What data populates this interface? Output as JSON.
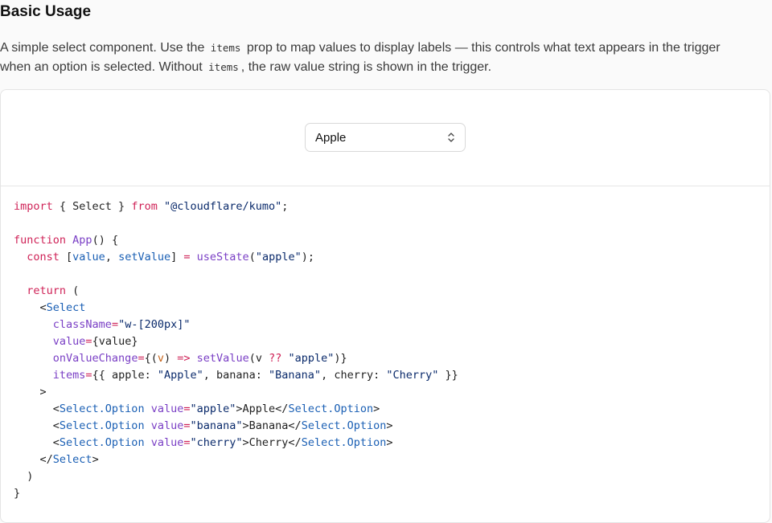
{
  "section": {
    "title": "Basic Usage",
    "description": {
      "part1": "A simple select component. Use the ",
      "code1": "items",
      "part2": " prop to map values to display labels — this controls what text appears in the trigger",
      "part3": "when an option is selected. Without ",
      "code2": "items",
      "part4": ", the raw value string is shown in the trigger."
    }
  },
  "preview": {
    "select": {
      "value": "Apple",
      "icon": "chevron-up-down-icon"
    }
  },
  "code_lines": [
    [
      {
        "t": "import",
        "c": "kw"
      },
      {
        "t": " { Select } ",
        "c": "plain"
      },
      {
        "t": "from",
        "c": "kw"
      },
      {
        "t": " ",
        "c": "plain"
      },
      {
        "t": "\"@cloudflare/kumo\"",
        "c": "str"
      },
      {
        "t": ";",
        "c": "plain"
      }
    ],
    [],
    [
      {
        "t": "function",
        "c": "kw"
      },
      {
        "t": " ",
        "c": "plain"
      },
      {
        "t": "App",
        "c": "fn"
      },
      {
        "t": "() {",
        "c": "plain"
      }
    ],
    [
      {
        "t": "  ",
        "c": "plain"
      },
      {
        "t": "const",
        "c": "kw"
      },
      {
        "t": " [",
        "c": "plain"
      },
      {
        "t": "value",
        "c": "tag"
      },
      {
        "t": ", ",
        "c": "plain"
      },
      {
        "t": "setValue",
        "c": "tag"
      },
      {
        "t": "] ",
        "c": "plain"
      },
      {
        "t": "=",
        "c": "op"
      },
      {
        "t": " ",
        "c": "plain"
      },
      {
        "t": "useState",
        "c": "fn"
      },
      {
        "t": "(",
        "c": "plain"
      },
      {
        "t": "\"apple\"",
        "c": "str"
      },
      {
        "t": ");",
        "c": "plain"
      }
    ],
    [],
    [
      {
        "t": "  ",
        "c": "plain"
      },
      {
        "t": "return",
        "c": "kw"
      },
      {
        "t": " (",
        "c": "plain"
      }
    ],
    [
      {
        "t": "    <",
        "c": "plain"
      },
      {
        "t": "Select",
        "c": "tag"
      }
    ],
    [
      {
        "t": "      ",
        "c": "plain"
      },
      {
        "t": "className",
        "c": "attr"
      },
      {
        "t": "=",
        "c": "op"
      },
      {
        "t": "\"w-[200px]\"",
        "c": "str"
      }
    ],
    [
      {
        "t": "      ",
        "c": "plain"
      },
      {
        "t": "value",
        "c": "attr"
      },
      {
        "t": "=",
        "c": "op"
      },
      {
        "t": "{value}",
        "c": "plain"
      }
    ],
    [
      {
        "t": "      ",
        "c": "plain"
      },
      {
        "t": "onValueChange",
        "c": "attr"
      },
      {
        "t": "=",
        "c": "op"
      },
      {
        "t": "{(",
        "c": "plain"
      },
      {
        "t": "v",
        "c": "prm"
      },
      {
        "t": ") ",
        "c": "plain"
      },
      {
        "t": "=>",
        "c": "op"
      },
      {
        "t": " ",
        "c": "plain"
      },
      {
        "t": "setValue",
        "c": "fn"
      },
      {
        "t": "(v ",
        "c": "plain"
      },
      {
        "t": "??",
        "c": "op"
      },
      {
        "t": " ",
        "c": "plain"
      },
      {
        "t": "\"apple\"",
        "c": "str"
      },
      {
        "t": ")}",
        "c": "plain"
      }
    ],
    [
      {
        "t": "      ",
        "c": "plain"
      },
      {
        "t": "items",
        "c": "attr"
      },
      {
        "t": "=",
        "c": "op"
      },
      {
        "t": "{{ apple: ",
        "c": "plain"
      },
      {
        "t": "\"Apple\"",
        "c": "str"
      },
      {
        "t": ", banana: ",
        "c": "plain"
      },
      {
        "t": "\"Banana\"",
        "c": "str"
      },
      {
        "t": ", cherry: ",
        "c": "plain"
      },
      {
        "t": "\"Cherry\"",
        "c": "str"
      },
      {
        "t": " }}",
        "c": "plain"
      }
    ],
    [
      {
        "t": "    >",
        "c": "plain"
      }
    ],
    [
      {
        "t": "      <",
        "c": "plain"
      },
      {
        "t": "Select.Option",
        "c": "tag"
      },
      {
        "t": " ",
        "c": "plain"
      },
      {
        "t": "value",
        "c": "attr"
      },
      {
        "t": "=",
        "c": "op"
      },
      {
        "t": "\"apple\"",
        "c": "str"
      },
      {
        "t": ">Apple</",
        "c": "plain"
      },
      {
        "t": "Select.Option",
        "c": "tag"
      },
      {
        "t": ">",
        "c": "plain"
      }
    ],
    [
      {
        "t": "      <",
        "c": "plain"
      },
      {
        "t": "Select.Option",
        "c": "tag"
      },
      {
        "t": " ",
        "c": "plain"
      },
      {
        "t": "value",
        "c": "attr"
      },
      {
        "t": "=",
        "c": "op"
      },
      {
        "t": "\"banana\"",
        "c": "str"
      },
      {
        "t": ">Banana</",
        "c": "plain"
      },
      {
        "t": "Select.Option",
        "c": "tag"
      },
      {
        "t": ">",
        "c": "plain"
      }
    ],
    [
      {
        "t": "      <",
        "c": "plain"
      },
      {
        "t": "Select.Option",
        "c": "tag"
      },
      {
        "t": " ",
        "c": "plain"
      },
      {
        "t": "value",
        "c": "attr"
      },
      {
        "t": "=",
        "c": "op"
      },
      {
        "t": "\"cherry\"",
        "c": "str"
      },
      {
        "t": ">Cherry</",
        "c": "plain"
      },
      {
        "t": "Select.Option",
        "c": "tag"
      },
      {
        "t": ">",
        "c": "plain"
      }
    ],
    [
      {
        "t": "    </",
        "c": "plain"
      },
      {
        "t": "Select",
        "c": "tag"
      },
      {
        "t": ">",
        "c": "plain"
      }
    ],
    [
      {
        "t": "  )",
        "c": "plain"
      }
    ],
    [
      {
        "t": "}",
        "c": "plain"
      }
    ]
  ]
}
